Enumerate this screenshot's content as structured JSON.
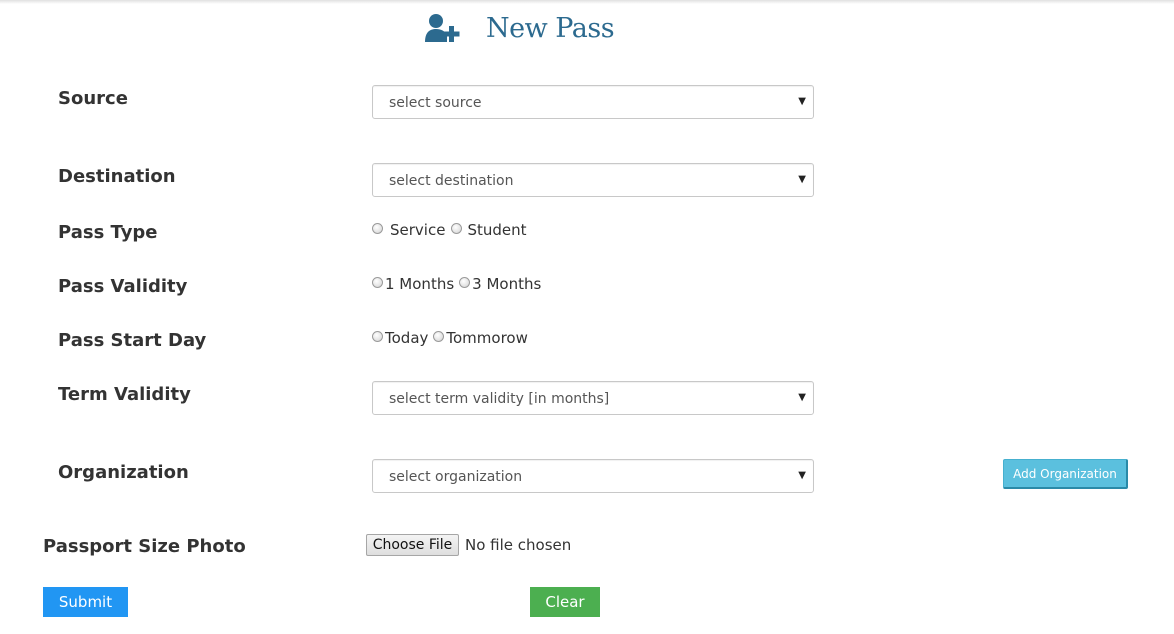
{
  "header": {
    "title": "New Pass",
    "icon": "add-user-icon",
    "accent_color": "#2c6a8f"
  },
  "form": {
    "source": {
      "label": "Source",
      "selected": "select source"
    },
    "destination": {
      "label": "Destination",
      "selected": "select destination"
    },
    "pass_type": {
      "label": "Pass Type",
      "options": [
        "Service",
        "Student"
      ]
    },
    "pass_validity": {
      "label": "Pass Validity",
      "options": [
        "1 Months",
        "3 Months"
      ]
    },
    "pass_start_day": {
      "label": "Pass Start Day",
      "options": [
        "Today",
        "Tommorow"
      ]
    },
    "term_validity": {
      "label": "Term Validity",
      "selected": "select term validity [in months]"
    },
    "organization": {
      "label": "Organization",
      "selected": "select organization",
      "add_button": "Add Organization"
    },
    "photo": {
      "label": "Passport Size Photo",
      "button": "Choose File",
      "status": "No file chosen"
    }
  },
  "actions": {
    "submit": "Submit",
    "clear": "Clear",
    "submit_color": "#2196f3",
    "clear_color": "#4caf50",
    "add_org_color": "#5bc0de"
  }
}
